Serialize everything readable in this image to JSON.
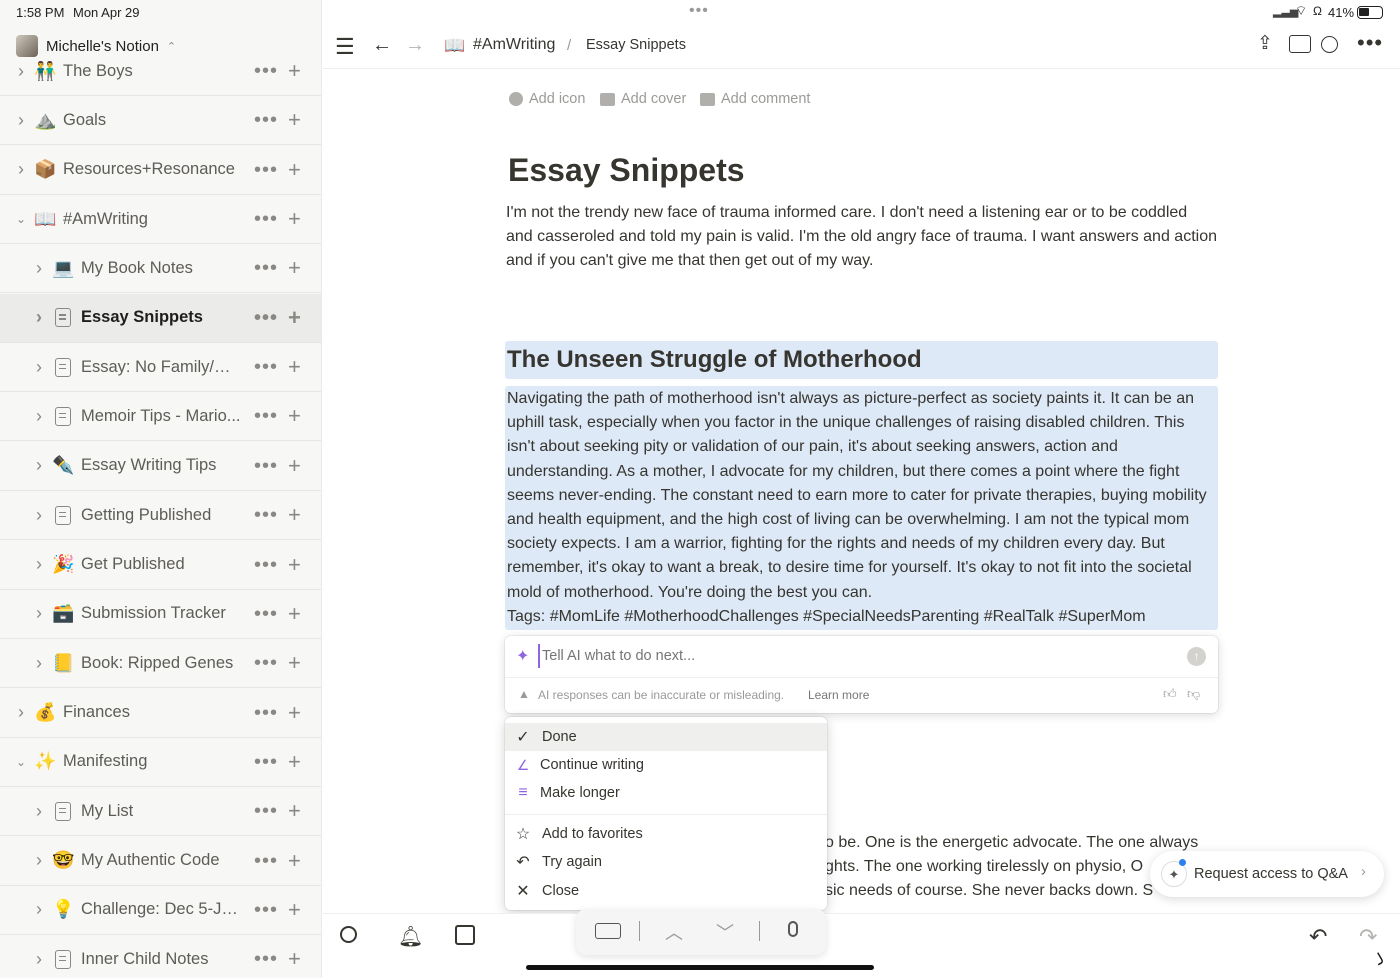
{
  "status": {
    "time": "1:58 PM",
    "date": "Mon Apr 29",
    "battery": "41%"
  },
  "workspace": {
    "name": "Michelle's Notion"
  },
  "sidebar": {
    "items": [
      {
        "label": "The Boys",
        "icon": "👬",
        "level": 0,
        "expanded": false,
        "active": false
      },
      {
        "label": "Goals",
        "icon": "⛰️",
        "level": 0,
        "expanded": false,
        "active": false
      },
      {
        "label": "Resources+Resonance",
        "icon": "📦",
        "level": 0,
        "expanded": false,
        "active": false
      },
      {
        "label": "#AmWriting",
        "icon": "📖",
        "level": 0,
        "expanded": true,
        "active": false
      },
      {
        "label": "My Book Notes",
        "icon": "💻",
        "level": 1,
        "expanded": false,
        "active": false
      },
      {
        "label": "Essay Snippets",
        "icon": "page-icon",
        "level": 1,
        "expanded": false,
        "active": true
      },
      {
        "label": "Essay: No Family/Se...",
        "icon": "page-icon",
        "level": 1,
        "expanded": false,
        "active": false
      },
      {
        "label": "Memoir Tips - Mario...",
        "icon": "page-icon",
        "level": 1,
        "expanded": false,
        "active": false
      },
      {
        "label": "Essay Writing Tips",
        "icon": "✒️",
        "level": 1,
        "expanded": false,
        "active": false
      },
      {
        "label": "Getting Published",
        "icon": "page-icon",
        "level": 1,
        "expanded": false,
        "active": false
      },
      {
        "label": "Get Published",
        "icon": "🎉",
        "level": 1,
        "expanded": false,
        "active": false
      },
      {
        "label": "Submission Tracker",
        "icon": "🗃️",
        "level": 1,
        "expanded": false,
        "active": false
      },
      {
        "label": "Book: Ripped Genes",
        "icon": "📒",
        "level": 1,
        "expanded": false,
        "active": false
      },
      {
        "label": "Finances",
        "icon": "💰",
        "level": 0,
        "expanded": false,
        "active": false
      },
      {
        "label": "Manifesting",
        "icon": "✨",
        "level": 0,
        "expanded": true,
        "active": false
      },
      {
        "label": "My List",
        "icon": "page-icon",
        "level": 1,
        "expanded": false,
        "active": false
      },
      {
        "label": "My Authentic Code",
        "icon": "🤓",
        "level": 1,
        "expanded": false,
        "active": false
      },
      {
        "label": "Challenge: Dec 5-Ja...",
        "icon": "💡",
        "level": 1,
        "expanded": false,
        "active": false
      },
      {
        "label": "Inner Child Notes",
        "icon": "page-icon",
        "level": 1,
        "expanded": false,
        "active": false
      }
    ]
  },
  "breadcrumb": {
    "parent_icon": "📖",
    "parent": "#AmWriting",
    "separator": "/",
    "current": "Essay Snippets"
  },
  "page_meta": {
    "add_icon": "Add icon",
    "add_cover": "Add cover",
    "add_comment": "Add comment"
  },
  "page": {
    "title": "Essay Snippets",
    "intro": "I'm not the trendy new face of trauma informed care. I don't need a listening ear or to be coddled and casseroled and told my pain is valid. I'm the old angry face of trauma. I want answers and action and if you can't give me that then get out of my way.",
    "heading": "The Unseen Struggle of Motherhood",
    "body": "Navigating the path of motherhood isn't always as picture-perfect as society paints it. It can be an uphill task, especially when you factor in the unique challenges of raising disabled children. This isn't about seeking pity or validation of our pain, it's about seeking answers, action and understanding. As a mother, I advocate for my children, but there comes a point where the fight seems never-ending. The constant need to earn more to cater for private therapies, buying mobility and health equipment, and the high cost of living can be overwhelming. I am not the typical mom society expects. I am a warrior, fighting for the rights and needs of my children every day. But remember, it's okay to want a break, to desire time for yourself. It's okay to not fit into the societal mold of motherhood. You're doing the best you can.",
    "tags": "Tags: #MomLife #MotherhoodChallenges #SpecialNeedsParenting #RealTalk #SuperMom",
    "partial_line_1": "o be. One is the energetic advocate. The one always",
    "partial_line_2": "ghts. The one working tirelessly on physio, O",
    "partial_line_3": "sic needs of course. She never backs down. S"
  },
  "ai": {
    "placeholder": "Tell AI what to do next...",
    "warning": "AI responses can be inaccurate or misleading.",
    "learn_more": "Learn more"
  },
  "ai_menu": {
    "done": "Done",
    "continue": "Continue writing",
    "longer": "Make longer",
    "favorites": "Add to favorites",
    "try_again": "Try again",
    "close": "Close"
  },
  "request_access": {
    "label": "Request access to Q&A"
  },
  "colors": {
    "selection": "#dde9f7",
    "sidebar_bg": "#f7f7f5",
    "ai_accent": "#9065e0"
  }
}
